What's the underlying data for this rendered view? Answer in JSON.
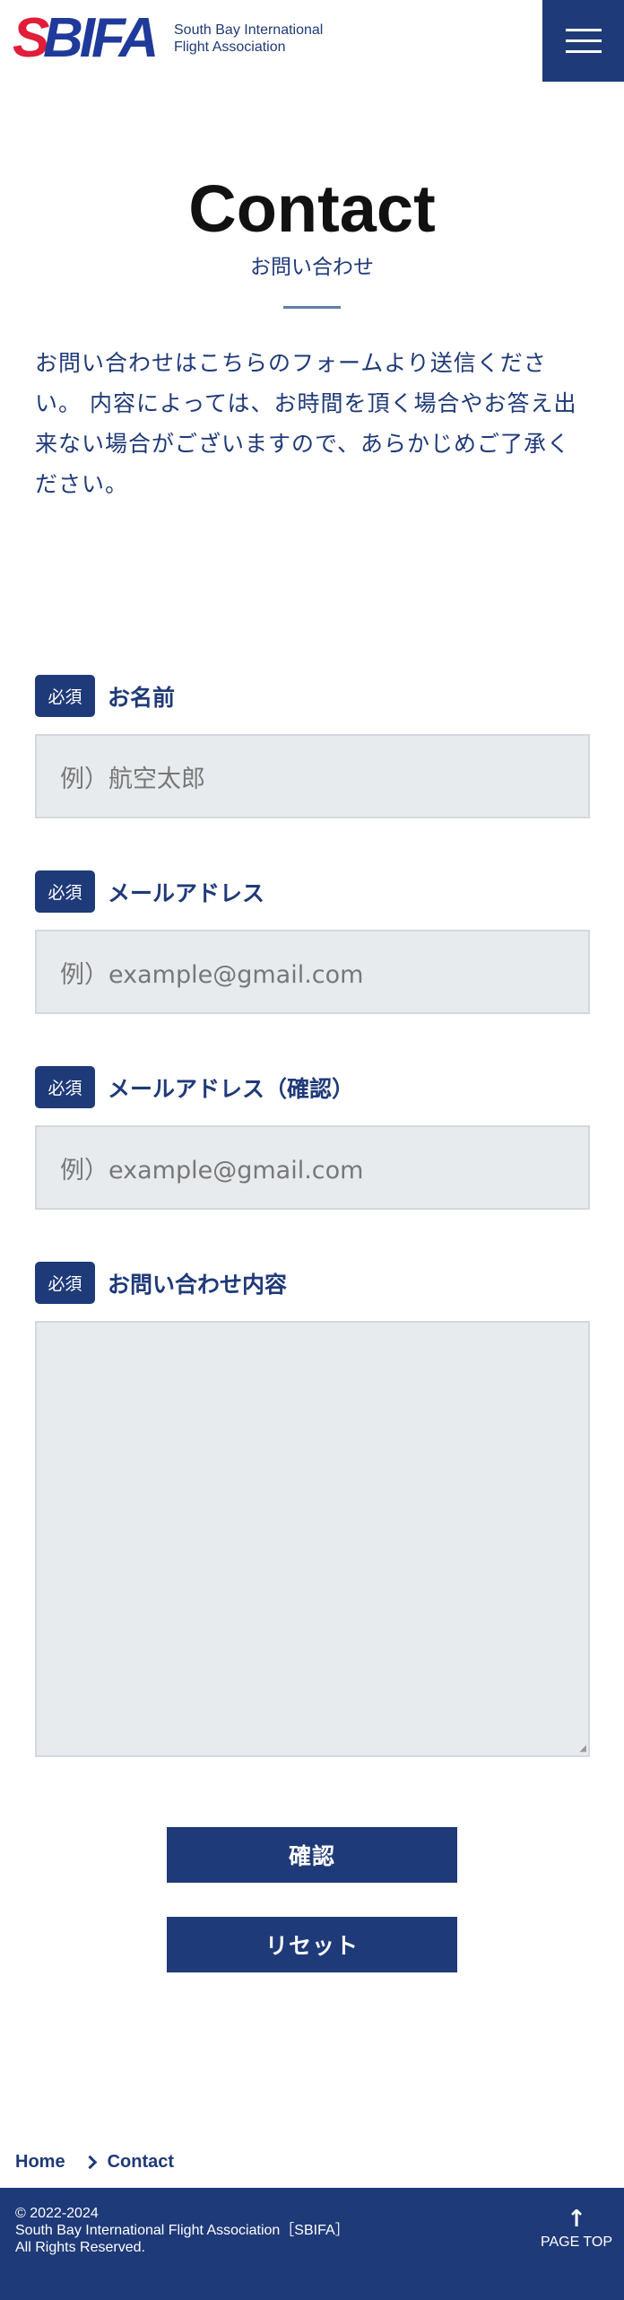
{
  "header": {
    "logo_mark_s": "S",
    "logo_mark_rest": "BIFA",
    "logo_line1": "South Bay International",
    "logo_line2": "Flight Association",
    "menu_icon": "hamburger-icon"
  },
  "page": {
    "title": "Contact",
    "subtitle": "お問い合わせ",
    "intro": "お問い合わせはこちらのフォームより送信くださ い。 内容によっては、お時間を頂く場合やお答え出来ない場合がございますので、あらかじめご了承ください。"
  },
  "form": {
    "required_badge": "必須",
    "name": {
      "label": "お名前",
      "placeholder": "例）航空太郎"
    },
    "email": {
      "label": "メールアドレス",
      "placeholder": "例）example@gmail.com"
    },
    "email_confirm": {
      "label": "メールアドレス（確認）",
      "placeholder": "例）example@gmail.com"
    },
    "message": {
      "label": "お問い合わせ内容",
      "placeholder": ""
    },
    "confirm_button": "確認",
    "reset_button": "リセット"
  },
  "breadcrumb": {
    "home": "Home",
    "current": "Contact"
  },
  "footer": {
    "copyright_line1": "©  2022-2024",
    "copyright_line2": "South Bay International Flight Association［SBIFA］",
    "copyright_line3": "All Rights Reserved.",
    "page_top_arrow": "↑",
    "page_top_label": "PAGE TOP"
  },
  "colors": {
    "brand_navy": "#1f3a78",
    "brand_red": "#e11d3a",
    "input_bg": "#e8ebee"
  }
}
